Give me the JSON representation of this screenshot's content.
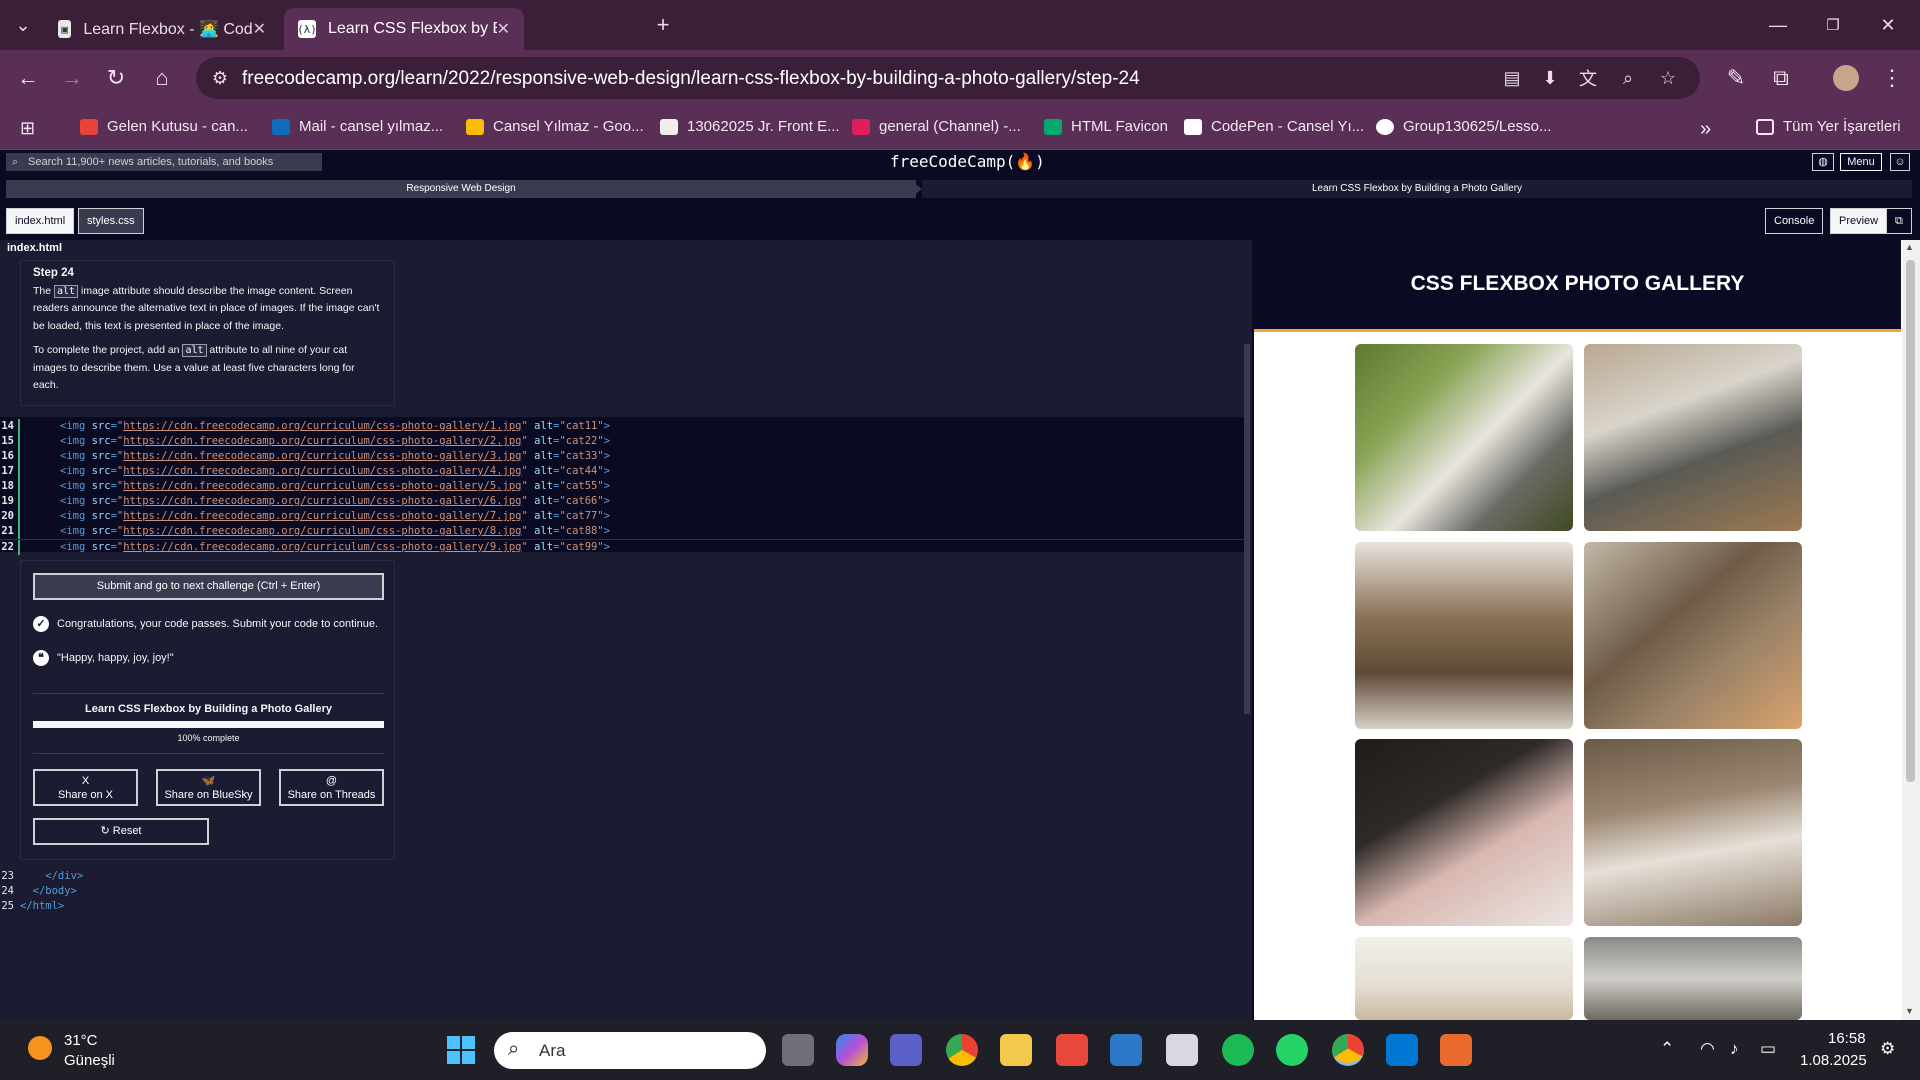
{
  "browser": {
    "tabs": [
      {
        "title": "Learn Flexbox - 👩‍💻 Coding Prac",
        "active": false
      },
      {
        "title": "Learn CSS Flexbox by Building a",
        "active": true
      }
    ],
    "url": "freecodecamp.org/learn/2022/responsive-web-design/learn-css-flexbox-by-building-a-photo-gallery/step-24",
    "bookmarks": [
      {
        "label": "Gelen Kutusu - can...",
        "color": "#ea4335"
      },
      {
        "label": "Mail - cansel yılmaz...",
        "color": "#0f6cbd"
      },
      {
        "label": "Cansel Yılmaz - Goo...",
        "color": "#fbbc04"
      },
      {
        "label": "13062025 Jr. Front E...",
        "color": "#ffffff"
      },
      {
        "label": "general (Channel) -...",
        "color": "#e01e5a"
      },
      {
        "label": "HTML Favicon",
        "color": "#04aa6d"
      },
      {
        "label": "CodePen - Cansel Yı...",
        "color": "#ffffff"
      },
      {
        "label": "Group130625/Lesso...",
        "color": "#ffffff"
      }
    ],
    "all_bookmarks": "Tüm Yer İşaretleri",
    "more_bookmarks": "»"
  },
  "fcc": {
    "search_placeholder": "Search 11,900+ news articles, tutorials, and books",
    "logo": "freeCodeCamp(🔥)",
    "menu": "Menu",
    "breadcrumb": [
      "Responsive Web Design",
      "Learn CSS Flexbox by Building a Photo Gallery"
    ],
    "file_tabs": [
      "index.html",
      "styles.css"
    ],
    "right_tabs": [
      "Console",
      "Preview"
    ]
  },
  "editor": {
    "file_title": "index.html",
    "step_title": "Step 24",
    "instr_p1_a": "The ",
    "instr_p1_code": "alt",
    "instr_p1_b": " image attribute should describe the image content. Screen readers announce the alternative text in place of images. If the image can't be loaded, this text is presented in place of the image.",
    "instr_p2_a": "To complete the project, add an ",
    "instr_p2_code": "alt",
    "instr_p2_b": " attribute to all nine of your cat images to describe them. Use a value at least five characters long for each.",
    "code_lines": [
      {
        "n": "14",
        "url": "https://cdn.freecodecamp.org/curriculum/css-photo-gallery/1.jpg",
        "alt": "\"cat11\""
      },
      {
        "n": "15",
        "url": "https://cdn.freecodecamp.org/curriculum/css-photo-gallery/2.jpg",
        "alt": "\"cat22\""
      },
      {
        "n": "16",
        "url": "https://cdn.freecodecamp.org/curriculum/css-photo-gallery/3.jpg",
        "alt": "\"cat33\""
      },
      {
        "n": "17",
        "url": "https://cdn.freecodecamp.org/curriculum/css-photo-gallery/4.jpg",
        "alt": "\"cat44\""
      },
      {
        "n": "18",
        "url": "https://cdn.freecodecamp.org/curriculum/css-photo-gallery/5.jpg",
        "alt": "\"cat55\""
      },
      {
        "n": "19",
        "url": "https://cdn.freecodecamp.org/curriculum/css-photo-gallery/6.jpg",
        "alt": "\"cat66\""
      },
      {
        "n": "20",
        "url": "https://cdn.freecodecamp.org/curriculum/css-photo-gallery/7.jpg",
        "alt": "\"cat77\""
      },
      {
        "n": "21",
        "url": "https://cdn.freecodecamp.org/curriculum/css-photo-gallery/8.jpg",
        "alt": "\"cat88\""
      },
      {
        "n": "22",
        "url": "https://cdn.freecodecamp.org/curriculum/css-photo-gallery/9.jpg",
        "alt": "\"cat99\""
      }
    ],
    "code_tail": [
      {
        "n": "23",
        "text": "    </div>"
      },
      {
        "n": "24",
        "text": "  </body>"
      },
      {
        "n": "25",
        "text": "</html>"
      }
    ],
    "submit": "Submit and go to next challenge (Ctrl + Enter)",
    "pass_msg": "Congratulations, your code passes. Submit your code to continue.",
    "quote": "\"Happy, happy, joy, joy!\"",
    "course_name": "Learn CSS Flexbox by Building a Photo Gallery",
    "progress": 1.0,
    "progress_label": "100% complete",
    "share": [
      {
        "icon": "X",
        "label": "Share on X"
      },
      {
        "icon": "🦋",
        "label": "Share on BlueSky"
      },
      {
        "icon": "@",
        "label": "Share on Threads"
      }
    ],
    "reset": "↻ Reset"
  },
  "preview": {
    "title": "CSS FLEXBOX PHOTO GALLERY",
    "header_bg": "#0a0a23",
    "accent": "#f9a33e"
  },
  "taskbar": {
    "temp": "31°C",
    "weather": "Güneşli",
    "search": "Ara",
    "time": "16:58",
    "date": "1.08.2025"
  }
}
